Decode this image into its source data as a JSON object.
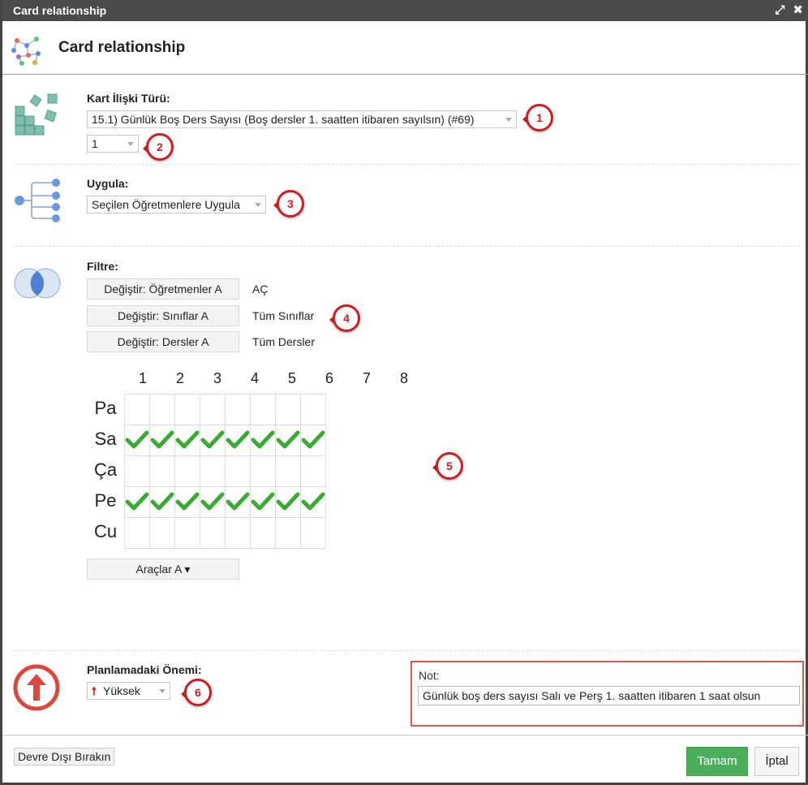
{
  "window": {
    "title": "Card relationship"
  },
  "header": {
    "title": "Card relationship"
  },
  "relation_type": {
    "label": "Kart İlişki Türü:",
    "selected": "15.1) Günlük Boş Ders Sayısı (Boş dersler 1. saatten itibaren sayılsın) (#69)",
    "count_selected": "1"
  },
  "apply": {
    "label": "Uygula:",
    "selected": "Seçilen Öğretmenlere Uygula"
  },
  "filter": {
    "label": "Filtre:",
    "rows": [
      {
        "button": "Değiştir: Öğretmenler A",
        "value": "AÇ"
      },
      {
        "button": "Değiştir: Sınıflar A",
        "value": "Tüm Sınıflar"
      },
      {
        "button": "Değiştir: Dersler A",
        "value": "Tüm Dersler"
      }
    ]
  },
  "grid": {
    "columns": [
      "1",
      "2",
      "3",
      "4",
      "5",
      "6",
      "7",
      "8"
    ],
    "rows": [
      "Pa",
      "Sa",
      "Ça",
      "Pe",
      "Cu"
    ],
    "checked": [
      [
        false,
        false,
        false,
        false,
        false,
        false,
        false,
        false
      ],
      [
        true,
        true,
        true,
        true,
        true,
        true,
        true,
        true
      ],
      [
        false,
        false,
        false,
        false,
        false,
        false,
        false,
        false
      ],
      [
        true,
        true,
        true,
        true,
        true,
        true,
        true,
        true
      ],
      [
        false,
        false,
        false,
        false,
        false,
        false,
        false,
        false
      ]
    ],
    "check_color": "#3aaa35"
  },
  "tools": {
    "label": "Araçlar A ▾"
  },
  "importance": {
    "label": "Planlamadaki Önemi:",
    "selected": "Yüksek",
    "icon": "red-up-arrow-icon"
  },
  "note": {
    "label": "Not:",
    "value": "Günlük boş ders sayısı Salı ve Perş 1. saatten itibaren 1 saat olsun"
  },
  "markers": [
    "1",
    "2",
    "3",
    "4",
    "5",
    "6"
  ],
  "footer": {
    "disable_label": "Devre Dışı Bırakın",
    "ok_label": "Tamam",
    "cancel_label": "İptal"
  },
  "colors": {
    "accent_red": "#cc1f25",
    "ok_green": "#4cae5a",
    "titlebar": "#4a4a4a"
  }
}
